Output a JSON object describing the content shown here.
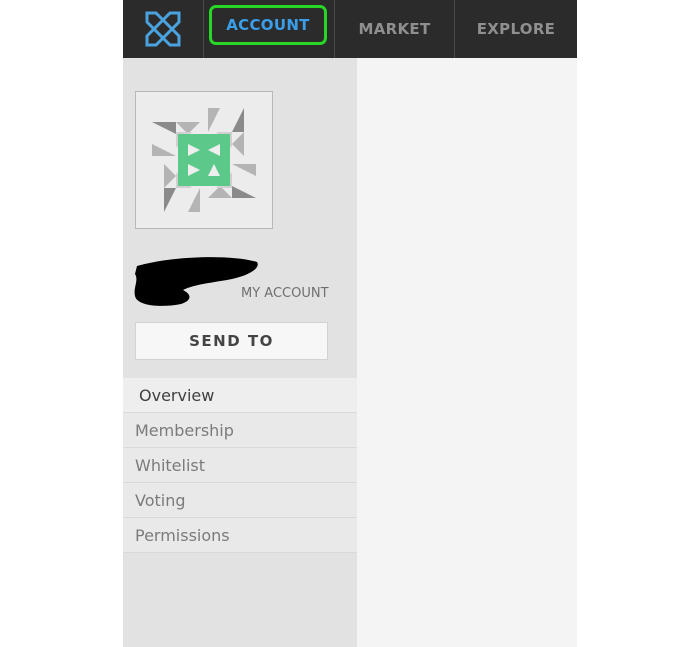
{
  "colors": {
    "nav_background": "#2b2b2b",
    "active_tab": "#3a9eea",
    "highlight_outline": "#27d627",
    "logo": "#4aa3df",
    "avatar_accent": "#5cc88a"
  },
  "header": {
    "logo_icon": "x-logo-icon",
    "tabs": [
      {
        "label": "ACCOUNT",
        "active": true
      },
      {
        "label": "MARKET",
        "active": false
      },
      {
        "label": "EXPLORE",
        "active": false
      }
    ]
  },
  "sidebar": {
    "avatar_icon": "identicon-avatar",
    "account_label": "MY ACCOUNT",
    "send_button_label": "SEND TO",
    "menu": [
      {
        "label": "Overview",
        "active": true
      },
      {
        "label": "Membership",
        "active": false
      },
      {
        "label": "Whitelist",
        "active": false
      },
      {
        "label": "Voting",
        "active": false
      },
      {
        "label": "Permissions",
        "active": false
      }
    ]
  }
}
